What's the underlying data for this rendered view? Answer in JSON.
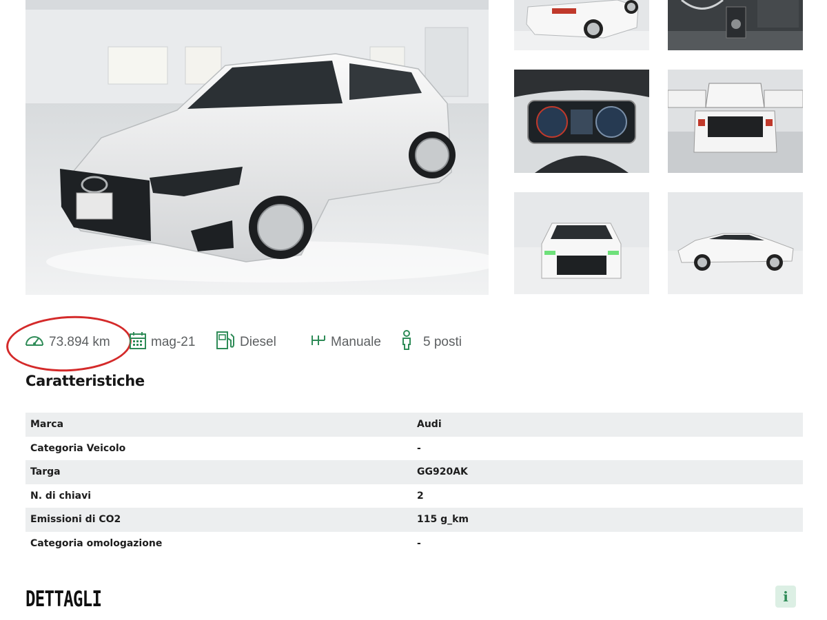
{
  "gallery": {
    "main_photo": "car-front-three-quarter-photo",
    "thumbnails": [
      "car-rear-three-quarter-photo",
      "car-interior-console-photo",
      "car-instrument-cluster-photo",
      "car-open-trunk-photo",
      "car-front-view-photo",
      "car-side-view-photo"
    ]
  },
  "specs": {
    "mileage": "73.894 km",
    "registration_date": "mag-21",
    "fuel": "Diesel",
    "transmission": "Manuale",
    "seats": "5 posti",
    "icons": [
      "speedometer-icon",
      "calendar-icon",
      "fuel-pump-icon",
      "gearbox-icon",
      "person-icon"
    ],
    "icon_color": "#2e8b57",
    "highlight_color": "#d42a2a"
  },
  "characteristics": {
    "title": "Caratteristiche",
    "rows": [
      {
        "label": "Marca",
        "value": "Audi"
      },
      {
        "label": "Categoria Veicolo",
        "value": "-"
      },
      {
        "label": "Targa",
        "value": "GG920AK"
      },
      {
        "label": "N. di chiavi",
        "value": "2"
      },
      {
        "label": "Emissioni di CO2",
        "value": "115 g_km"
      },
      {
        "label": "Categoria omologazione",
        "value": "-"
      }
    ]
  },
  "details": {
    "title": "DETTAGLI",
    "info_icon": "i",
    "info_icon_name": "info-icon"
  }
}
